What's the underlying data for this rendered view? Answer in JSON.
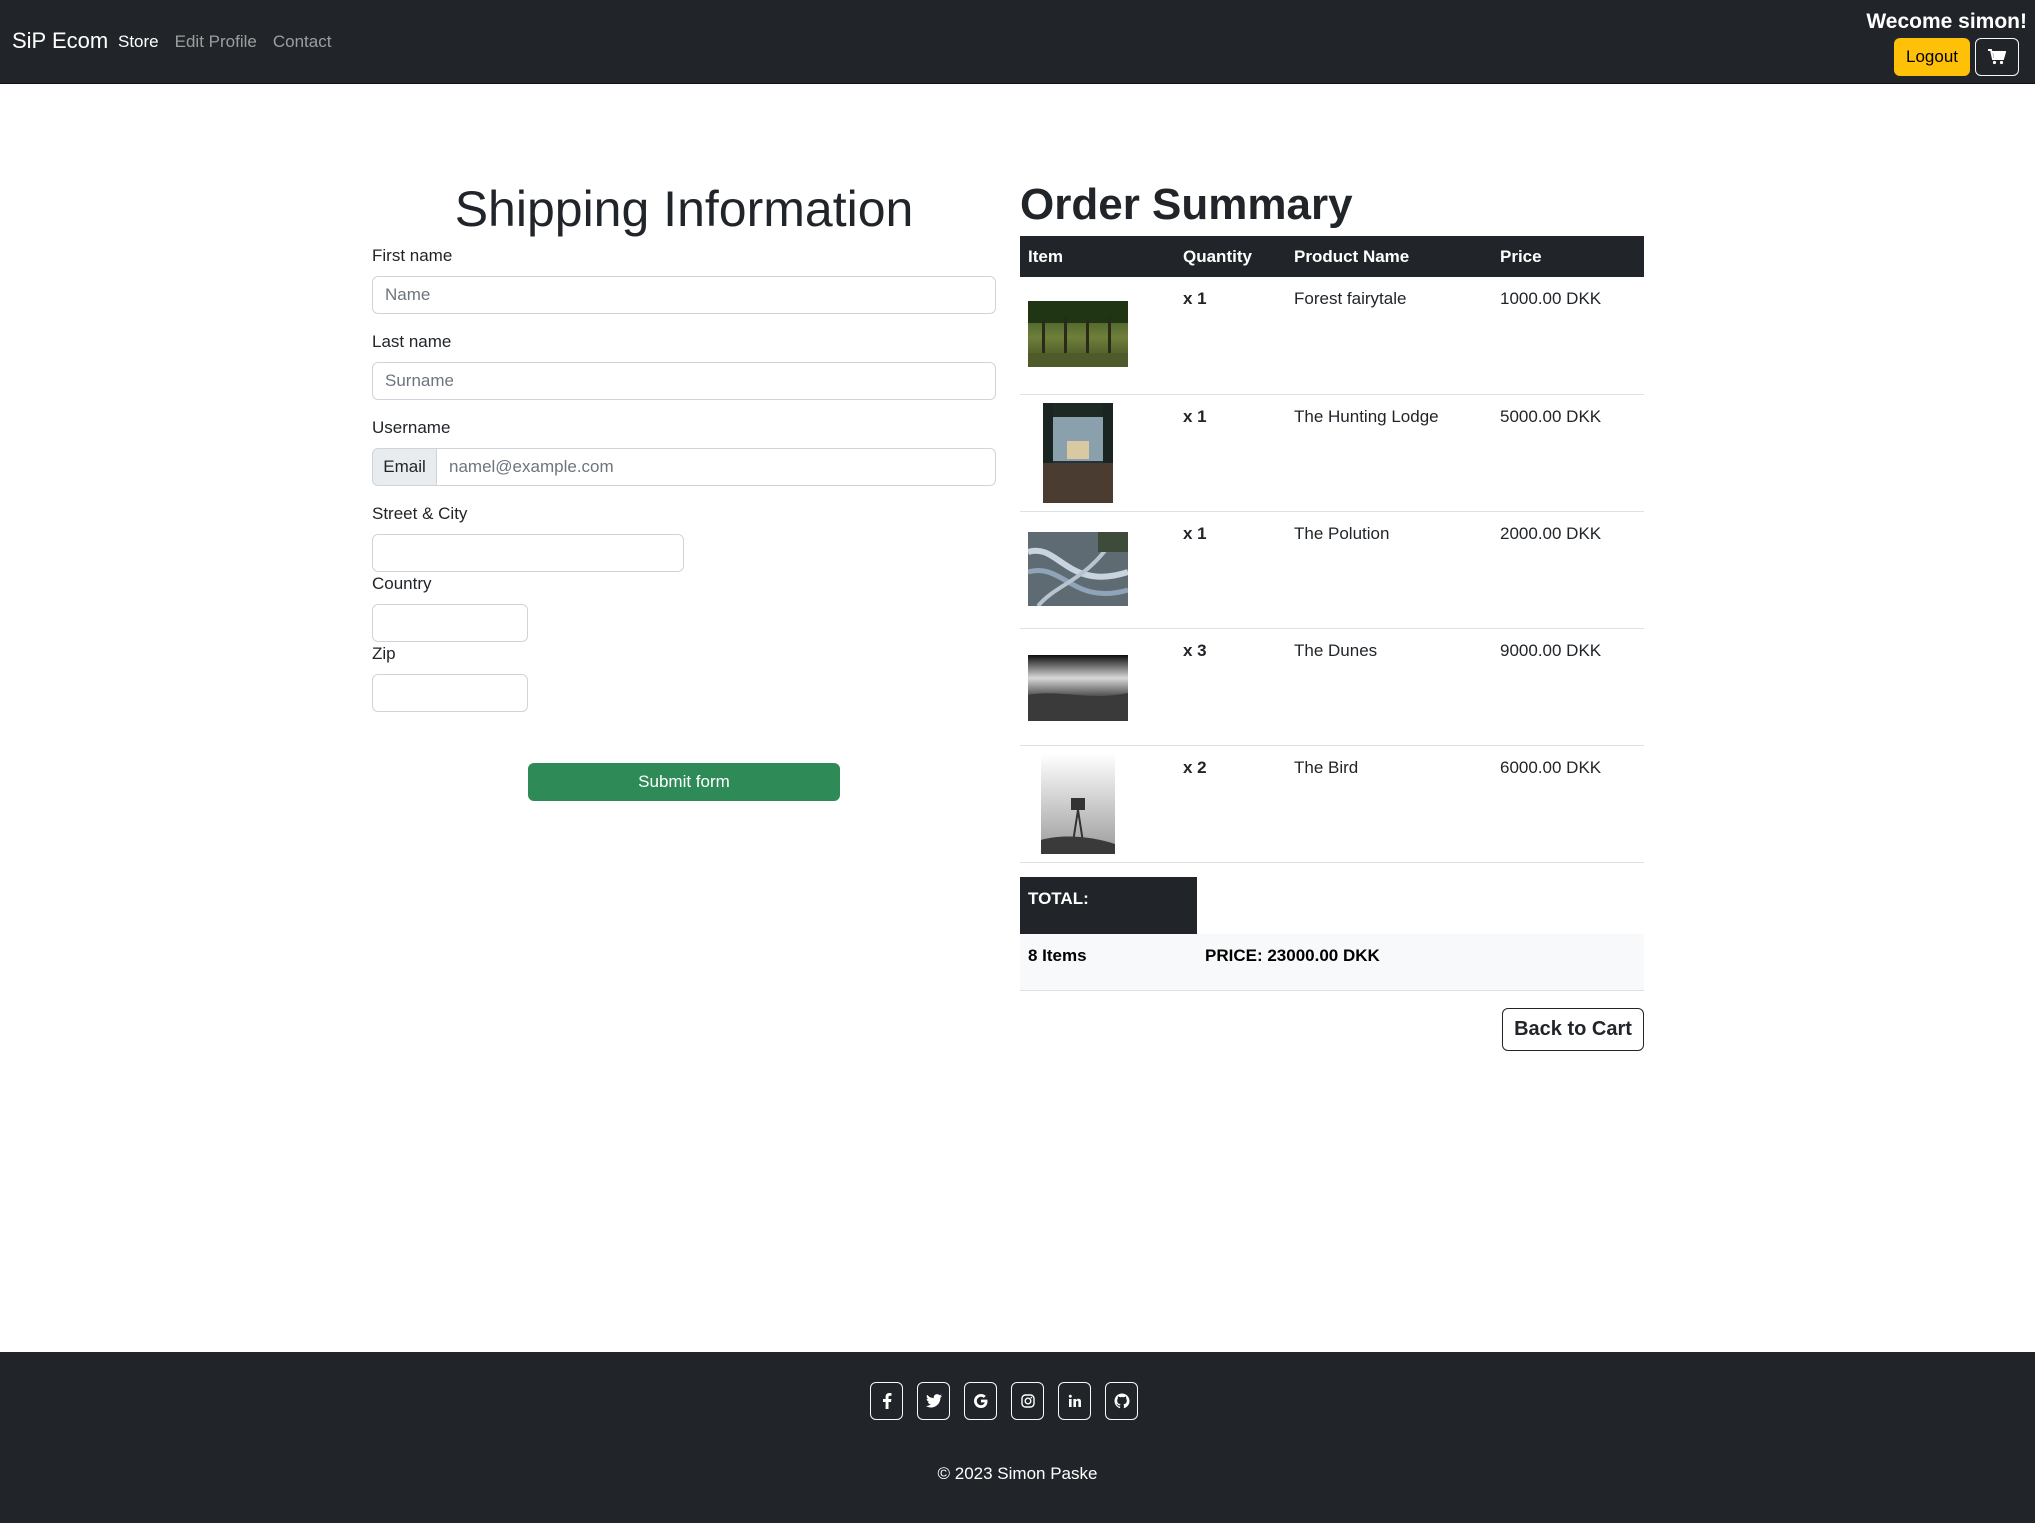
{
  "navbar": {
    "brand": "SiP Ecom",
    "links": [
      "Store",
      "Edit Profile",
      "Contact"
    ],
    "welcome": "Wecome simon!",
    "logout_label": "Logout",
    "cart_icon": "cart-icon"
  },
  "shipping": {
    "title": "Shipping Information",
    "first_name_label": "First name",
    "first_name_placeholder": "Name",
    "last_name_label": "Last name",
    "last_name_placeholder": "Surname",
    "username_label": "Username",
    "email_addon": "Email",
    "email_placeholder": "namel@example.com",
    "street_label": "Street & City",
    "country_label": "Country",
    "zip_label": "Zip",
    "submit_label": "Submit form"
  },
  "order": {
    "title": "Order Summary",
    "headers": [
      "Item",
      "Quantity",
      "Product Name",
      "Price"
    ],
    "items": [
      {
        "qty": "x 1",
        "name": "Forest fairytale",
        "price": "1000.00 DKK",
        "image": "forest-image"
      },
      {
        "qty": "x 1",
        "name": "The Hunting Lodge",
        "price": "5000.00 DKK",
        "image": "lodge-image"
      },
      {
        "qty": "x 1",
        "name": "The Polution",
        "price": "2000.00 DKK",
        "image": "polution-image"
      },
      {
        "qty": "x 3",
        "name": "The Dunes",
        "price": "9000.00 DKK",
        "image": "dunes-image"
      },
      {
        "qty": "x 2",
        "name": "The Bird",
        "price": "6000.00 DKK",
        "image": "bird-image"
      }
    ],
    "total_label": "TOTAL:",
    "total_items": "8 Items",
    "total_price": "PRICE: 23000.00 DKK",
    "back_label": "Back to Cart"
  },
  "footer": {
    "social": [
      "facebook-icon",
      "twitter-icon",
      "google-icon",
      "instagram-icon",
      "linkedin-icon",
      "github-icon"
    ],
    "copyright": "© 2023 Simon Paske"
  }
}
